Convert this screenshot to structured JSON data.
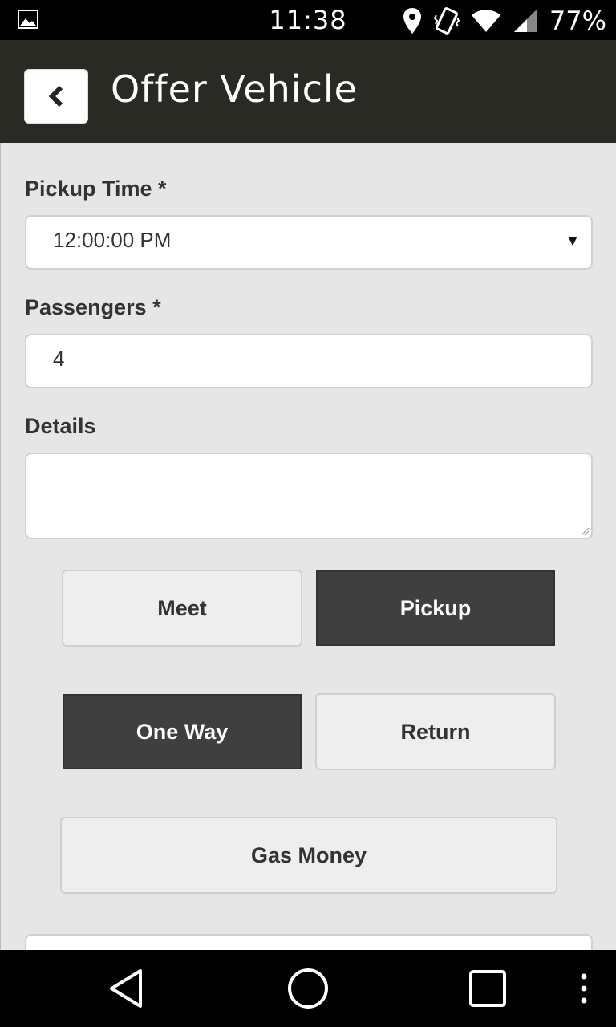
{
  "status_bar": {
    "time": "11:38",
    "battery": "77%",
    "icons": [
      "image-icon",
      "location-icon",
      "vibrate-icon",
      "wifi-icon",
      "signal-icon"
    ]
  },
  "header": {
    "title": "Offer Vehicle",
    "back_icon": "chevron-left-icon"
  },
  "form": {
    "pickup_time": {
      "label": "Pickup Time *",
      "value": "12:00:00 PM"
    },
    "passengers": {
      "label": "Passengers *",
      "value": "4"
    },
    "details": {
      "label": "Details",
      "value": ""
    },
    "meet_button": {
      "label": "Meet",
      "selected": false
    },
    "pickup_button": {
      "label": "Pickup",
      "selected": true
    },
    "one_way_button": {
      "label": "One Way",
      "selected": true
    },
    "return_button": {
      "label": "Return",
      "selected": false
    },
    "gas_money_button": {
      "label": "Gas Money",
      "selected": false
    }
  },
  "nav_bar": {
    "icons": [
      "back-triangle-icon",
      "home-circle-icon",
      "recents-square-icon",
      "overflow-menu-icon"
    ]
  },
  "colors": {
    "header_bg": "#2a2a25",
    "selected_bg": "#3f3f3f",
    "page_bg": "#e6e6e6"
  }
}
